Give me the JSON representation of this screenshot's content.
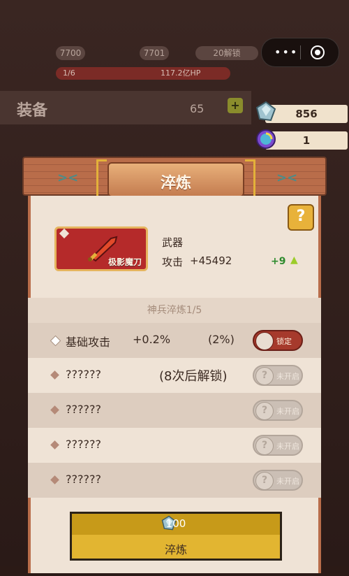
{
  "background": {
    "level_left": "7700",
    "level_right": "7701",
    "unlock_text": "20解锁",
    "progress": "1/6",
    "hp": "117.2亿HP",
    "equip_title": "装备",
    "equip_value": "65"
  },
  "currency": {
    "gems": "856",
    "orbs": "1"
  },
  "modal": {
    "title": "淬炼",
    "help": "?",
    "weapon": {
      "name": "极影魔刀",
      "type": "武器",
      "attack_label": "攻击",
      "attack_value": "+45492",
      "bonus": "+9"
    },
    "subtitle": "神兵淬炼1/5",
    "rows": [
      {
        "name": "基础攻击",
        "value": "+0.2%",
        "pct": "(2%)",
        "toggle": "锁定",
        "state": "locked"
      },
      {
        "name": "??????",
        "unlock": "(8次后解锁)",
        "toggle": "未开启",
        "state": "closed"
      },
      {
        "name": "??????",
        "toggle": "未开启",
        "state": "closed"
      },
      {
        "name": "??????",
        "toggle": "未开启",
        "state": "closed"
      },
      {
        "name": "??????",
        "toggle": "未开启",
        "state": "closed"
      }
    ],
    "refine_button": {
      "cost": "100",
      "label": "淬炼"
    }
  },
  "colors": {
    "modal_bg": "#efe3d6",
    "header_wood": "#b96d4a",
    "weapon_card": "#b52a2a",
    "locked_toggle": "#a63a2c",
    "bonus_green": "#2e8b2e",
    "button_gold": "#e2b531"
  }
}
